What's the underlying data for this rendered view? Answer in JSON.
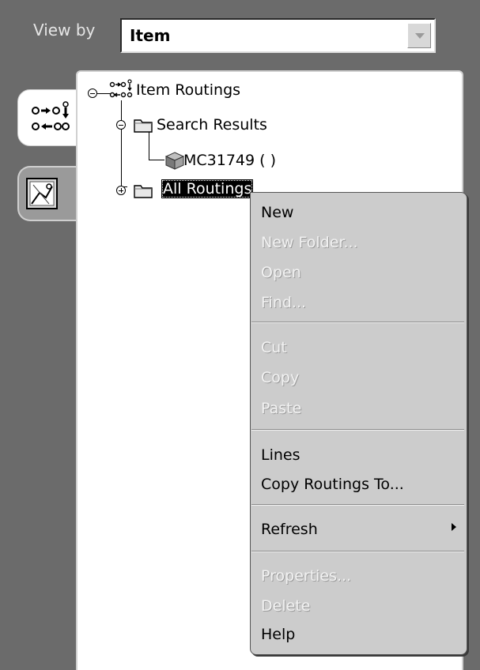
{
  "toolbar": {
    "view_by_label": "View by",
    "view_by_value": "Item"
  },
  "side_tabs": [
    {
      "icon": "routing-flow-icon"
    },
    {
      "icon": "chart-panel-icon"
    }
  ],
  "tree": {
    "root": "Item Routings",
    "search_results": "Search Results",
    "result_item": "MC31749 ( )",
    "all_routings": "All Routings"
  },
  "context_menu": {
    "new": "New",
    "new_folder": "New Folder...",
    "open": "Open",
    "find": "Find...",
    "cut": "Cut",
    "copy": "Copy",
    "paste": "Paste",
    "lines": "Lines",
    "copy_routings_to": "Copy Routings To...",
    "refresh": "Refresh",
    "properties": "Properties...",
    "delete": "Delete",
    "help": "Help"
  },
  "colors": {
    "background": "#6b6b6b",
    "menu_background": "#cccccc",
    "selection": "#000000"
  }
}
